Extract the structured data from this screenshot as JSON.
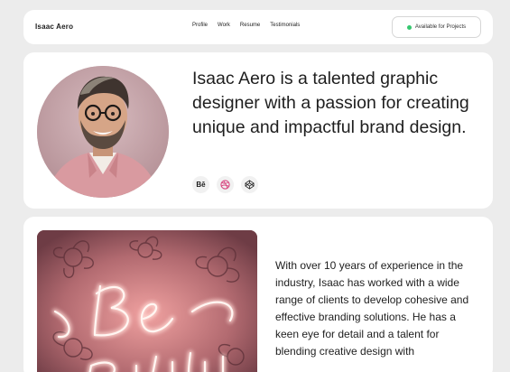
{
  "nav": {
    "brand": "Isaac Aero",
    "links": [
      "Profile",
      "Work",
      "Resume",
      "Testimonials"
    ],
    "status": "Available for Projects",
    "status_color": "#35c76f"
  },
  "hero": {
    "headline": "Isaac Aero is a talented graphic designer with a passion for creating unique and impactful brand design.",
    "socials": [
      {
        "label": "Bē",
        "icon": "behance-icon"
      },
      {
        "label": "",
        "icon": "dribbble-icon"
      },
      {
        "label": "",
        "icon": "codepen-icon"
      }
    ]
  },
  "about": {
    "bio": "With over 10 years of experience in the industry, Isaac has worked with a wide range of clients to develop cohesive and effective branding solutions. He has a keen eye for detail and a talent for blending creative design with"
  }
}
